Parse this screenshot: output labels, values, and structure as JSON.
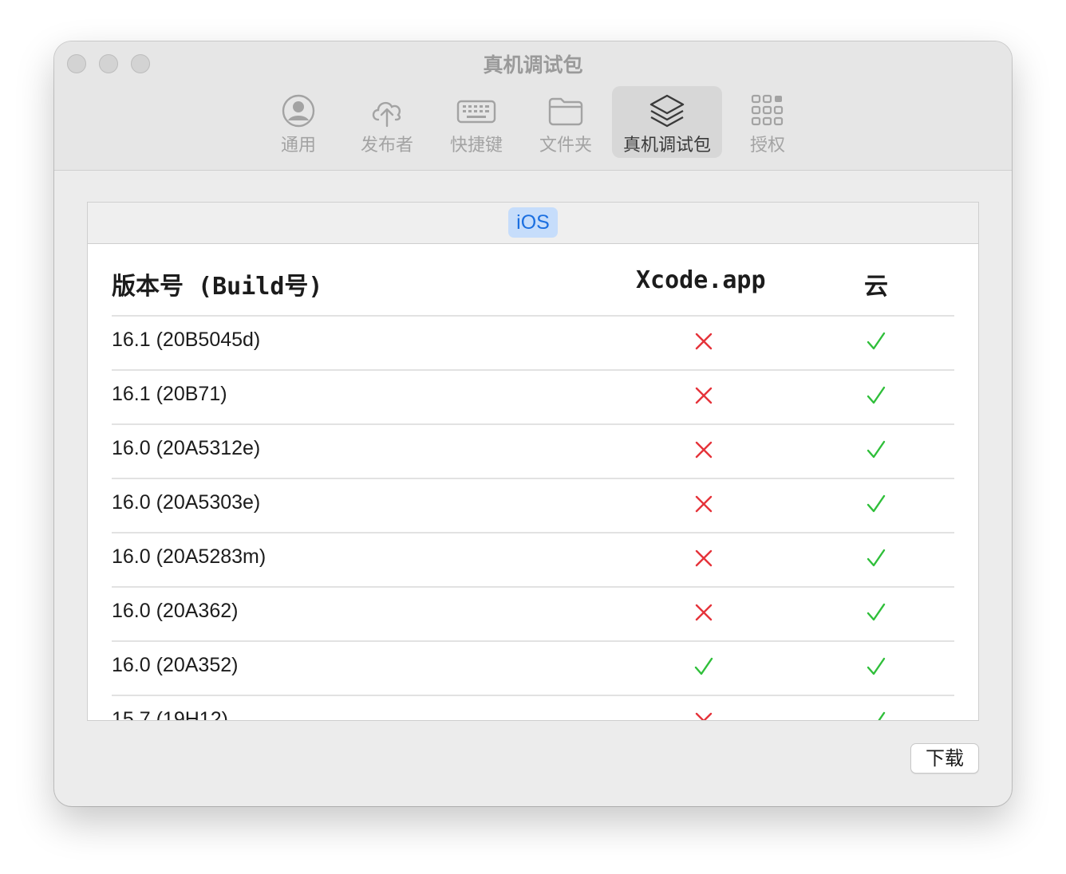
{
  "window": {
    "title": "真机调试包"
  },
  "toolbar": {
    "tabs": [
      {
        "label": "通用",
        "icon": "person-circle-icon",
        "active": false
      },
      {
        "label": "发布者",
        "icon": "cloud-upload-icon",
        "active": false
      },
      {
        "label": "快捷键",
        "icon": "keyboard-icon",
        "active": false
      },
      {
        "label": "文件夹",
        "icon": "folder-icon",
        "active": false
      },
      {
        "label": "真机调试包",
        "icon": "stack-layers-icon",
        "active": true
      },
      {
        "label": "授权",
        "icon": "grid-apps-icon",
        "active": false
      }
    ]
  },
  "platform": {
    "selected": "iOS"
  },
  "table": {
    "headers": {
      "version": "版本号 (Build号)",
      "xcode": "Xcode.app",
      "cloud": "云"
    },
    "rows": [
      {
        "version": "16.1 (20B5045d)",
        "xcode": false,
        "cloud": true
      },
      {
        "version": "16.1 (20B71)",
        "xcode": false,
        "cloud": true
      },
      {
        "version": "16.0 (20A5312e)",
        "xcode": false,
        "cloud": true
      },
      {
        "version": "16.0 (20A5303e)",
        "xcode": false,
        "cloud": true
      },
      {
        "version": "16.0 (20A5283m)",
        "xcode": false,
        "cloud": true
      },
      {
        "version": "16.0 (20A362)",
        "xcode": false,
        "cloud": true
      },
      {
        "version": "16.0 (20A352)",
        "xcode": true,
        "cloud": true
      },
      {
        "version": "15.7 (19H12)",
        "xcode": false,
        "cloud": true
      }
    ]
  },
  "footer": {
    "download_label": "下载"
  },
  "colors": {
    "cross": "#e5333a",
    "check": "#2fbf3a",
    "accent": "#1b6fe0"
  }
}
